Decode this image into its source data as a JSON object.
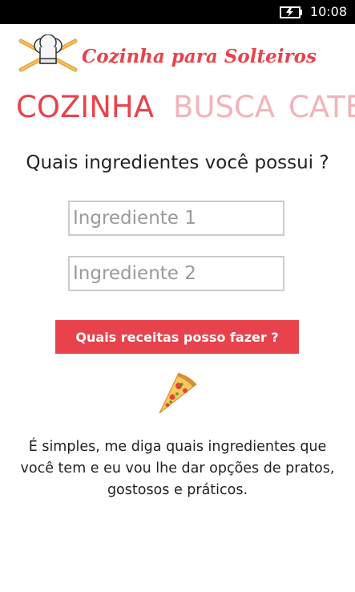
{
  "status_bar": {
    "time": "10:08"
  },
  "header": {
    "app_title": "Cozinha para Solteiros"
  },
  "pivot": {
    "tabs": [
      "COZINHA",
      "BUSCA",
      "CATE"
    ]
  },
  "main": {
    "question": "Quais ingredientes você possui ?",
    "ingredient1_placeholder": "Ingrediente 1",
    "ingredient2_placeholder": "Ingrediente 2",
    "button_label": "Quais receitas posso fazer ?",
    "description": "É simples, me diga quais ingredientes que você tem e eu vou lhe dar opções de pratos, gostosos e práticos."
  },
  "colors": {
    "accent": "#e8434c",
    "inactive_tab": "#f2b4b9"
  },
  "icons": [
    "battery-charging-icon",
    "chef-hat-logo-icon",
    "pizza-slice-icon"
  ]
}
